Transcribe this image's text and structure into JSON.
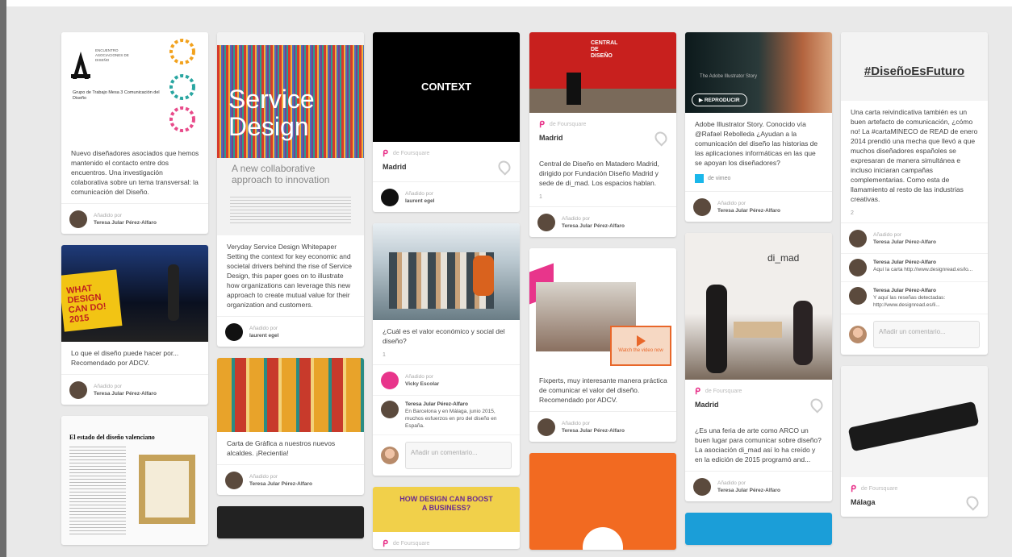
{
  "labels": {
    "added_by": "Añadido por",
    "comment_placeholder": "Añadir un comentario..."
  },
  "col1": [
    {
      "logo_text": "ENCUENTRO ASOCIACIONES DE DISEÑO",
      "doc_text": "Grupo de Trabajo Mesa 3 Comunicación del Diseño",
      "desc": "Nuevo diseñadores asociados que hemos mantenido el contacto entre dos encuentros. Una investigación colaborativa sobre un tema transversal: la comunicación del Diseño.",
      "user": "Teresa Jular Pérez-Alfaro"
    },
    {
      "sign": "WHAT DESIGN CAN DO! 2015",
      "desc": "Lo que el diseño puede hacer por... Recomendado por ADCV.",
      "user": "Teresa Jular Pérez-Alfaro"
    },
    {
      "headline": "El estado del diseño valenciano"
    }
  ],
  "col2": [
    {
      "title1": "Service",
      "title2": "Design",
      "subtitle": "A new collaborative approach to innovation",
      "desc": "Veryday Service Design Whitepaper Setting the context for key economic and societal drivers behind the rise of Service Design, this paper goes on to illustrate how organizations can leverage this new approach to create mutual value for their organization and customers.",
      "user": "laurent egel"
    },
    {
      "desc": "Carta de Gràfica a nuestros nuevos alcaldes. ¡Recientia!",
      "user": "Teresa Jular Pérez-Alfaro"
    }
  ],
  "col3": [
    {
      "img_text": "CONTEXT",
      "source": "de Foursquare",
      "place": "Madrid",
      "user": "laurent egel"
    },
    {
      "desc": "¿Cuál es el valor económico y social del diseño?",
      "stat": "1",
      "user": "Vicky Escolar",
      "comment_user": "Teresa Jular Pérez-Alfaro",
      "comment": "En Barcelona y en Málaga, junio 2015, muchos esfuerzos en pro del diseño en España."
    },
    {
      "img_text": "HOW DESIGN CAN BOOST A BUSINESS?",
      "source": "de Foursquare"
    }
  ],
  "col4": [
    {
      "img_text": "CENTRAL DE DISEÑO",
      "source": "de Foursquare",
      "place": "Madrid",
      "desc": "Central de Diseño en Matadero Madrid, dirigido por Fundación Diseño Madrid y sede de di_mad. Los espacios hablan.",
      "stat": "1",
      "user": "Teresa Jular Pérez-Alfaro"
    },
    {
      "img_text": "Watch the video now",
      "desc": "Fixperts, muy interesante manera práctica de comunicar el valor del diseño. Recomendado por ADCV.",
      "user": "Teresa Jular Pérez-Alfaro"
    }
  ],
  "col5": [
    {
      "img_text": "The Adobe Illustrator Story",
      "button": "REPRODUCIR",
      "desc": "Adobe Illustrator Story. Conocido vía @Rafael Rebolleda ¿Ayudan a la comunicación del diseño las historias de las aplicaciones informáticas en las que se apoyan los diseñadores?",
      "source": "de vimeo",
      "user": "Teresa Jular Pérez-Alfaro"
    },
    {
      "img_text": "di_mad",
      "source": "de Foursquare",
      "place": "Madrid",
      "desc": "¿Es una feria de arte como ARCO un buen lugar para comunicar sobre diseño? La asociación di_mad así lo ha creído y en la edición de 2015 programó and...",
      "user": "Teresa Jular Pérez-Alfaro"
    }
  ],
  "col6": [
    {
      "hashtag": "#DiseñoEsFuturo",
      "desc": "Una carta reivindicativa también es un buen artefacto de comunicación, ¿cómo no! La #cartaMINECO de READ de enero 2014 prendió una mecha que llevó a que muchos diseñadores españoles se expresaran de manera simultánea e incluso iniciaran campañas complementarias. Como esta de llamamiento al resto de las industrias creativas.",
      "stat": "2",
      "user": "Teresa Jular Pérez-Alfaro",
      "comments": [
        {
          "name": "Teresa Jular Pérez-Alfaro",
          "text": "Aquí la carta http://www.designread.es/lo..."
        },
        {
          "name": "Teresa Jular Pérez-Alfaro",
          "text": "Y aquí las reseñas detectadas: http://www.designread.es/li..."
        }
      ]
    },
    {
      "source": "de Foursquare",
      "place": "Málaga"
    }
  ]
}
